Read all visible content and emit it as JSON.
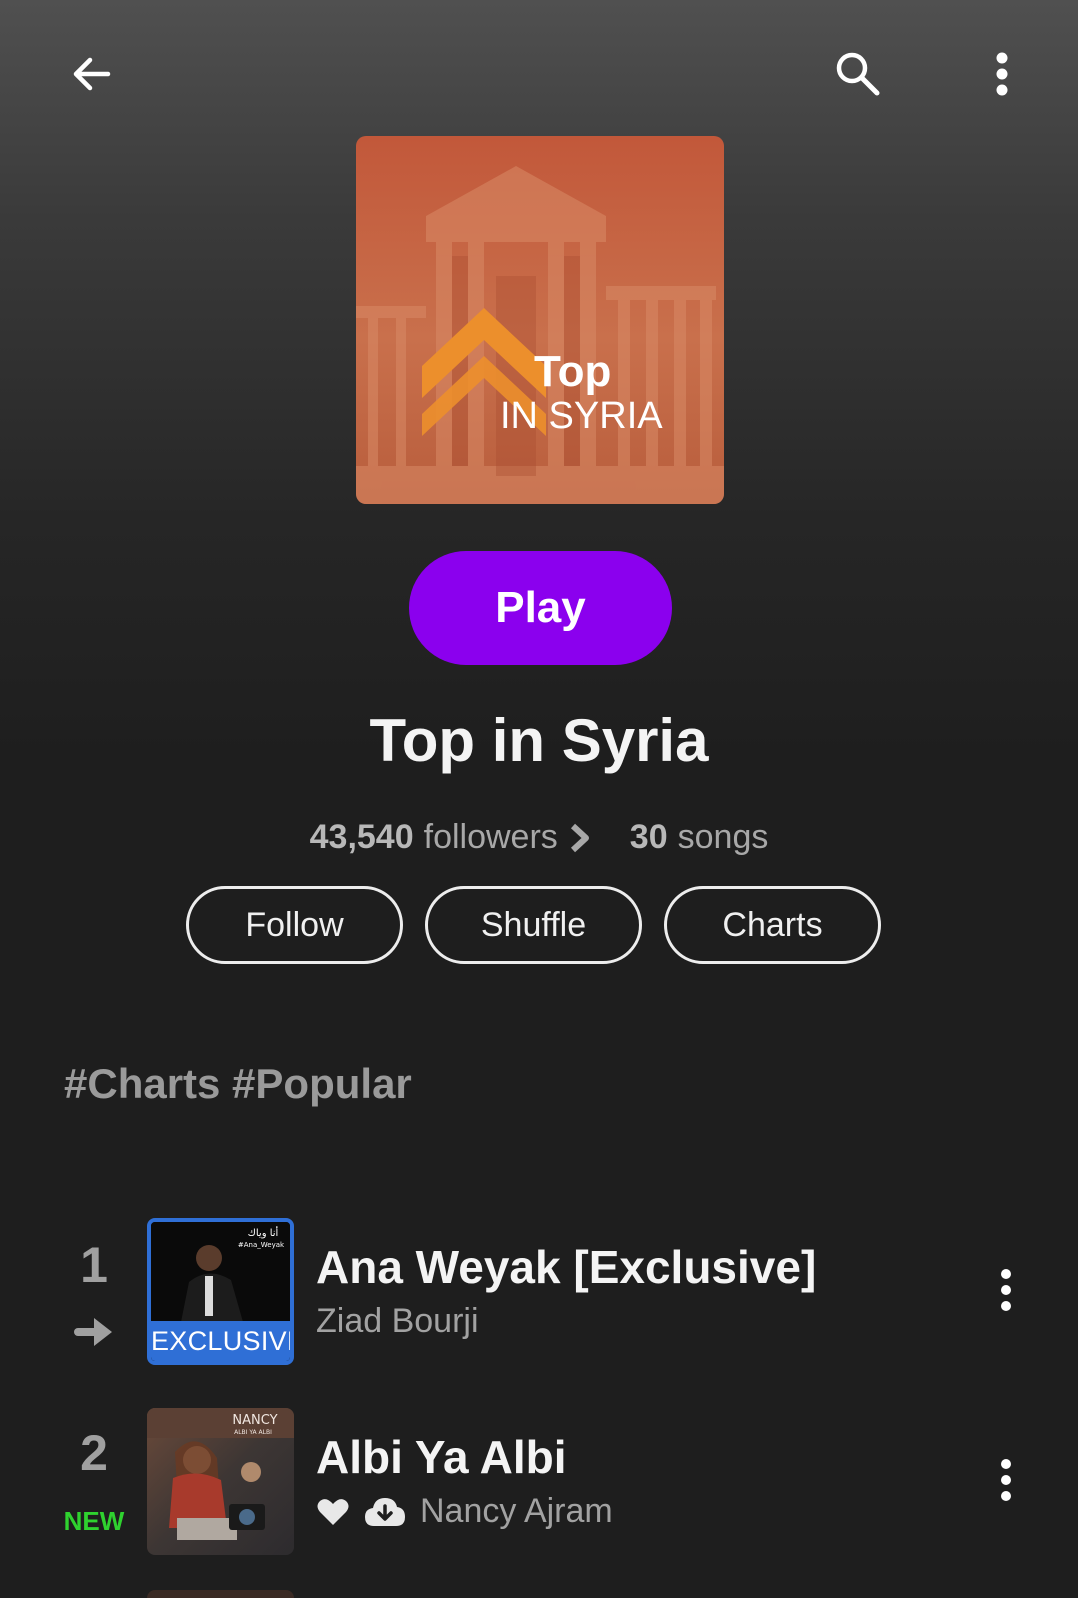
{
  "header": {
    "back_icon": "arrow-left-icon",
    "search_icon": "search-icon",
    "more_icon": "more-vertical-icon"
  },
  "cover": {
    "line1": "Top",
    "line2": "IN SYRIA",
    "accent": "#e8892a",
    "tint": "#c86a45"
  },
  "play_label": "Play",
  "playlist_title": "Top in Syria",
  "stats": {
    "followers_count": "43,540",
    "followers_label": "followers",
    "songs_count": "30",
    "songs_label": "songs"
  },
  "actions": {
    "follow": "Follow",
    "shuffle": "Shuffle",
    "charts": "Charts"
  },
  "tags": "#Charts #Popular",
  "tracks": [
    {
      "rank": "1",
      "trend": "arrow-right",
      "title": "Ana Weyak [Exclusive]",
      "artist": "Ziad Bourji",
      "badge": "EXCLUSIVE",
      "thumb_text1": "أنا وياك",
      "thumb_text2": "#Ana_Weyak"
    },
    {
      "rank": "2",
      "trend": "NEW",
      "title": "Albi Ya Albi",
      "artist": "Nancy Ajram",
      "thumb_text1": "NANCY",
      "thumb_text2": "ALBI YA ALBI"
    }
  ],
  "colors": {
    "play_button": "#8b00ee",
    "new_badge": "#2fd22f",
    "exclusive_badge": "#2f6fd6"
  }
}
